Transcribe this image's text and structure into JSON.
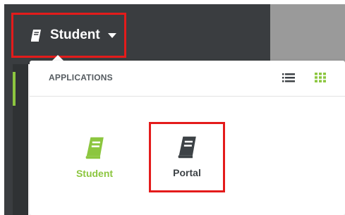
{
  "header": {
    "app_switcher": {
      "label": "Student",
      "icon": "book-icon",
      "caret_icon": "caret-down-icon"
    }
  },
  "panel": {
    "title": "APPLICATIONS",
    "view_toggles": [
      {
        "icon": "list-view-icon"
      },
      {
        "icon": "grid-view-icon",
        "active": true
      }
    ],
    "apps": [
      {
        "label": "Student",
        "icon": "book-icon",
        "color": "#8cc63f"
      },
      {
        "label": "Portal",
        "icon": "book-icon",
        "color": "#3d4246"
      }
    ]
  },
  "colors": {
    "accent_green": "#8cc63f",
    "highlight_red": "#e41b1b",
    "topbar_dark": "#3a3d40"
  }
}
